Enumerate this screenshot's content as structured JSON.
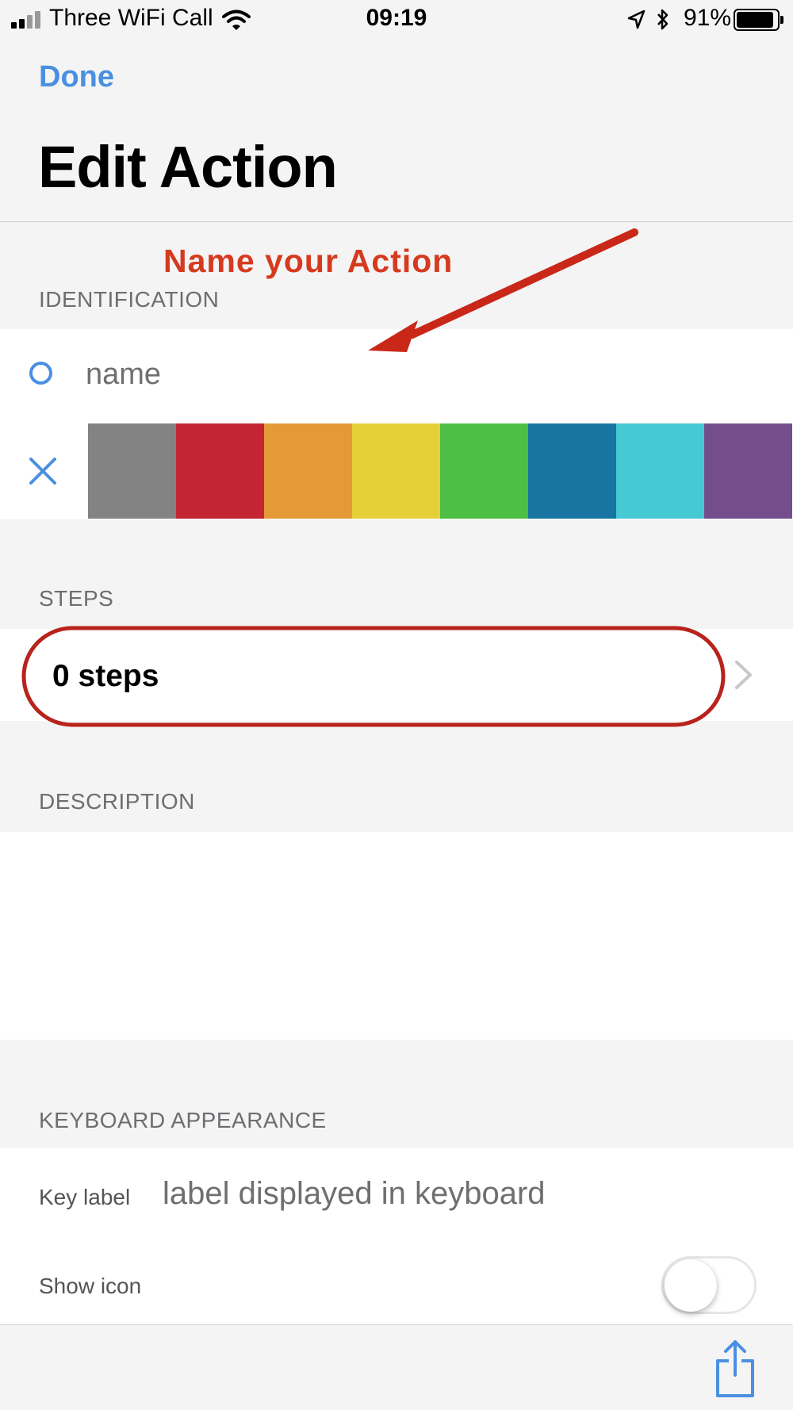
{
  "status_bar": {
    "carrier": "Three WiFi Call",
    "time": "09:19",
    "battery_percent": "91%",
    "battery_level": 0.91,
    "icons": [
      "signal-icon",
      "wifi-icon",
      "location-arrow-icon",
      "bluetooth-icon",
      "battery-icon"
    ]
  },
  "nav": {
    "done_label": "Done",
    "title": "Edit Action"
  },
  "annotation": {
    "text": "Name your Action",
    "color": "#d63a1e"
  },
  "identification": {
    "header": "IDENTIFICATION",
    "name_placeholder": "name",
    "swatch_colors": [
      "#838383",
      "#c42532",
      "#e39a37",
      "#e6d03a",
      "#4cbf44",
      "#1775a1",
      "#45c9d2",
      "#744e8c"
    ]
  },
  "steps": {
    "header": "STEPS",
    "label": "0 steps"
  },
  "description": {
    "header": "DESCRIPTION"
  },
  "keyboard_appearance": {
    "header": "KEYBOARD APPEARANCE",
    "key_label": "Key label",
    "key_placeholder": "label displayed in keyboard",
    "show_icon_label": "Show icon",
    "show_icon_on": false
  },
  "colors": {
    "accent": "#4a90e2",
    "highlight": "#b8231c",
    "background": "#f4f4f4"
  }
}
